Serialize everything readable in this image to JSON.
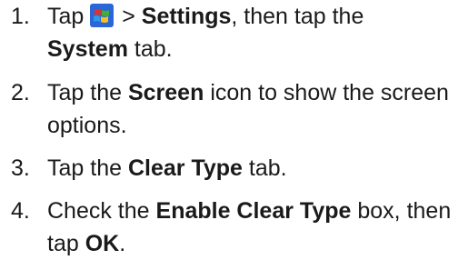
{
  "steps": [
    {
      "number": "1.",
      "tap": "Tap",
      "icon": "windows-start-icon",
      "sep": ">",
      "settings": "Settings",
      "mid": ", then tap the",
      "system": "System",
      "end": "tab."
    },
    {
      "number": "2.",
      "pre": "Tap the",
      "screen": "Screen",
      "post": "icon to show the screen options."
    },
    {
      "number": "3.",
      "pre": "Tap the",
      "clear_type": "Clear Type",
      "post": "tab."
    },
    {
      "number": "4.",
      "pre": "Check the",
      "enable_clear_type": "Enable Clear Type",
      "mid": "box, then tap",
      "ok": "OK",
      "end": "."
    }
  ],
  "colors": {
    "text": "#1a1a1a",
    "icon_blue": "#2a66d8",
    "icon_red": "#e0312a",
    "icon_green": "#3fae3a",
    "icon_yellow": "#f4c21b"
  }
}
